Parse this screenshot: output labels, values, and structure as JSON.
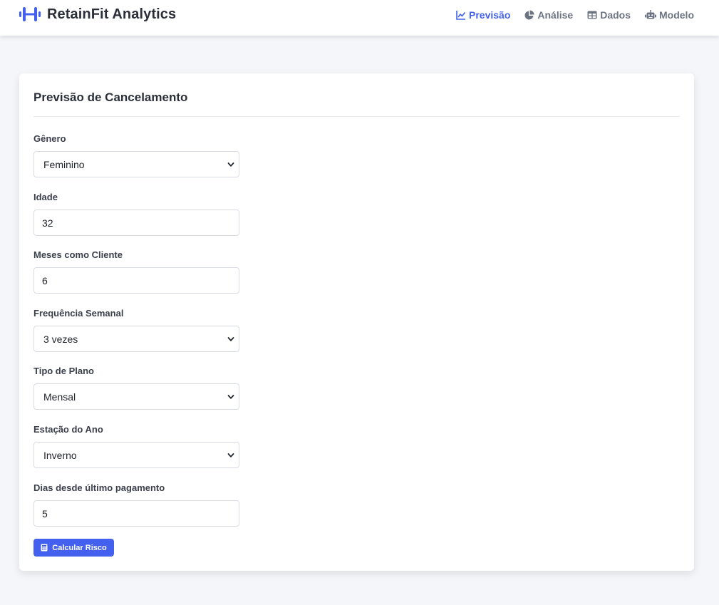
{
  "app": {
    "brand": "RetainFit Analytics",
    "brand_icon": "dumbbell-icon",
    "accent_color": "#4361ee"
  },
  "nav": {
    "items": [
      {
        "label": "Previsão",
        "icon": "chart-line-icon",
        "active": true
      },
      {
        "label": "Análise",
        "icon": "chart-pie-icon",
        "active": false
      },
      {
        "label": "Dados",
        "icon": "table-icon",
        "active": false
      },
      {
        "label": "Modelo",
        "icon": "robot-icon",
        "active": false
      }
    ]
  },
  "form": {
    "title": "Previsão de Cancelamento",
    "fields": [
      {
        "label": "Gênero",
        "type": "select",
        "value": "Feminino"
      },
      {
        "label": "Idade",
        "type": "number",
        "value": "32"
      },
      {
        "label": "Meses como Cliente",
        "type": "number",
        "value": "6"
      },
      {
        "label": "Frequência Semanal",
        "type": "select",
        "value": "3 vezes"
      },
      {
        "label": "Tipo de Plano",
        "type": "select",
        "value": "Mensal"
      },
      {
        "label": "Estação do Ano",
        "type": "select",
        "value": "Inverno"
      },
      {
        "label": "Dias desde último pagamento",
        "type": "number",
        "value": "5"
      }
    ],
    "submit_label": "Calcular Risco",
    "submit_icon": "calculator-icon"
  }
}
